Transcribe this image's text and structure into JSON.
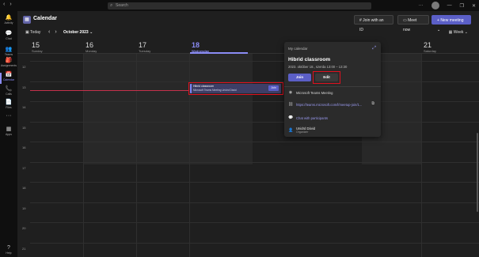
{
  "titlebar": {
    "search_placeholder": "Search"
  },
  "rail": {
    "items": [
      {
        "label": "Activity",
        "icon": "bell-icon",
        "glyph": "🔔"
      },
      {
        "label": "Chat",
        "icon": "chat-icon",
        "glyph": "💬"
      },
      {
        "label": "Teams",
        "icon": "teams-icon",
        "glyph": "👥"
      },
      {
        "label": "Assignments",
        "icon": "assignments-icon",
        "glyph": "🎒"
      },
      {
        "label": "Calendar",
        "icon": "calendar-icon",
        "glyph": "📅"
      },
      {
        "label": "Calls",
        "icon": "phone-icon",
        "glyph": "📞"
      },
      {
        "label": "Files",
        "icon": "file-icon",
        "glyph": "📄"
      },
      {
        "label": "",
        "icon": "more-icon",
        "glyph": "···"
      },
      {
        "label": "Apps",
        "icon": "apps-icon",
        "glyph": "▦"
      },
      {
        "label": "Help",
        "icon": "help-icon",
        "glyph": "?"
      }
    ],
    "active_index": 4
  },
  "header": {
    "title": "Calendar",
    "join_with_id": "Join with an ID",
    "meet_now": "Meet now",
    "new_meeting": "New meeting"
  },
  "toolbar": {
    "today": "Today",
    "month": "October 2023",
    "view": "Week"
  },
  "days": [
    {
      "num": "15",
      "name": "Sunday"
    },
    {
      "num": "16",
      "name": "Monday"
    },
    {
      "num": "17",
      "name": "Tuesday"
    },
    {
      "num": "18",
      "name": "Wednesday",
      "today": true
    },
    {
      "num": "19",
      "name": "Thursday"
    },
    {
      "num": "20",
      "name": "Friday"
    },
    {
      "num": "21",
      "name": "Saturday"
    }
  ],
  "hours": [
    "12",
    "13",
    "14",
    "15",
    "16",
    "17",
    "18",
    "19",
    "20",
    "21"
  ],
  "event": {
    "title": "Hibrid classroom",
    "subtitle": "Microsoft Teams Meeting  Unidrd Dávid",
    "join": "Join"
  },
  "popup": {
    "calendar": "My calendar",
    "title": "Hibrid classroom",
    "time": "2023. október 18., szerda 13:00 – 13:30",
    "join": "Join",
    "edit": "Edit",
    "meeting_type": "Microsoft Teams Meeting",
    "link": "https://teams.microsoft.com/l/meetup-join/1...",
    "chat": "Chat with participants",
    "organizer_name": "Unidrd Dávid",
    "organizer_role": "Organizer"
  }
}
